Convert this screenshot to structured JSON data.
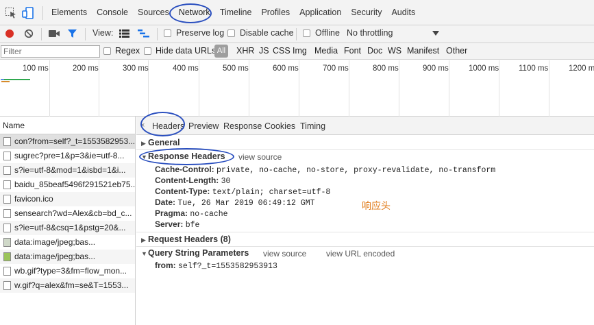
{
  "devtools_tabs": [
    "Elements",
    "Console",
    "Sources",
    "Network",
    "Timeline",
    "Profiles",
    "Application",
    "Security",
    "Audits"
  ],
  "toolbar": {
    "view_label": "View:",
    "preserve_log": "Preserve log",
    "disable_cache": "Disable cache",
    "offline": "Offline",
    "throttling": "No throttling"
  },
  "filter": {
    "placeholder": "Filter",
    "regex": "Regex",
    "hide_data_urls": "Hide data URLs",
    "all": "All",
    "types": [
      "XHR",
      "JS",
      "CSS",
      "Img",
      "Media",
      "Font",
      "Doc",
      "WS",
      "Manifest",
      "Other"
    ]
  },
  "overview_ticks": [
    "100 ms",
    "200 ms",
    "300 ms",
    "400 ms",
    "500 ms",
    "600 ms",
    "700 ms",
    "800 ms",
    "900 ms",
    "1000 ms",
    "1100 ms",
    "1200 m"
  ],
  "list": {
    "header": "Name",
    "rows": [
      "con?from=self?_t=1553582953...",
      "sugrec?pre=1&p=3&ie=utf-8...",
      "s?ie=utf-8&mod=1&isbd=1&i...",
      "baidu_85beaf5496f291521eb75...",
      "favicon.ico",
      "sensearch?wd=Alex&cb=bd_c...",
      "s?ie=utf-8&csq=1&pstg=20&...",
      "data:image/jpeg;bas...",
      "data:image/jpeg;bas...",
      "wb.gif?type=3&fm=flow_mon...",
      "w.gif?q=alex&fm=se&T=1553..."
    ]
  },
  "details": {
    "close": "×",
    "tabs": [
      "Headers",
      "Preview",
      "Response",
      "Cookies",
      "Timing"
    ],
    "general": "General",
    "response_headers": "Response Headers",
    "view_source": "view source",
    "headers": [
      {
        "k": "Cache-Control:",
        "v": "private, no-cache, no-store, proxy-revalidate, no-transform"
      },
      {
        "k": "Content-Length:",
        "v": "30"
      },
      {
        "k": "Content-Type:",
        "v": "text/plain; charset=utf-8"
      },
      {
        "k": "Date:",
        "v": "Tue, 26 Mar 2019 06:49:12 GMT"
      },
      {
        "k": "Pragma:",
        "v": "no-cache"
      },
      {
        "k": "Server:",
        "v": "bfe"
      }
    ],
    "request_headers": "Request Headers (8)",
    "query_string": "Query String Parameters",
    "view_source2": "view source",
    "view_url_encoded": "view URL encoded",
    "query_param": {
      "k": "from:",
      "v": "self?_t=1553582953913"
    },
    "annotation": "响应头"
  },
  "colors": {
    "record": "#d93025",
    "accent": "#2a4fbf",
    "annotation": "#e07b1a"
  }
}
